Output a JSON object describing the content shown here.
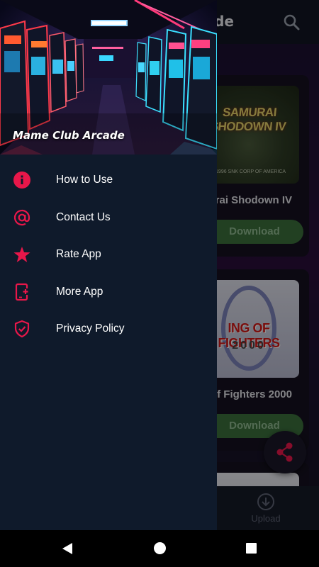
{
  "app": {
    "title": "de",
    "games": [
      {
        "name": "rai Shodown IV",
        "thumb_logo": "SAMURAI SHODOWN IV",
        "thumb_copy": "©1996 SNK CORP OF AMERICA",
        "download_label": "Download"
      },
      {
        "name": "g of Fighters 2000",
        "thumb_logo": "ING OF FIGHTERS",
        "thumb_year": "2000",
        "download_label": "Download"
      }
    ],
    "bottom_nav": {
      "upload_label": "Upload"
    }
  },
  "drawer": {
    "title": "Mame Club Arcade",
    "items": [
      {
        "label": "How to Use",
        "icon": "info-icon"
      },
      {
        "label": "Contact Us",
        "icon": "at-icon"
      },
      {
        "label": "Rate App",
        "icon": "star-icon"
      },
      {
        "label": "More App",
        "icon": "phone-add-icon"
      },
      {
        "label": "Privacy Policy",
        "icon": "shield-check-icon"
      }
    ]
  },
  "colors": {
    "accent": "#e8174a",
    "drawer_bg": "#0f1a2b",
    "download_button": "#3b6f3c"
  }
}
